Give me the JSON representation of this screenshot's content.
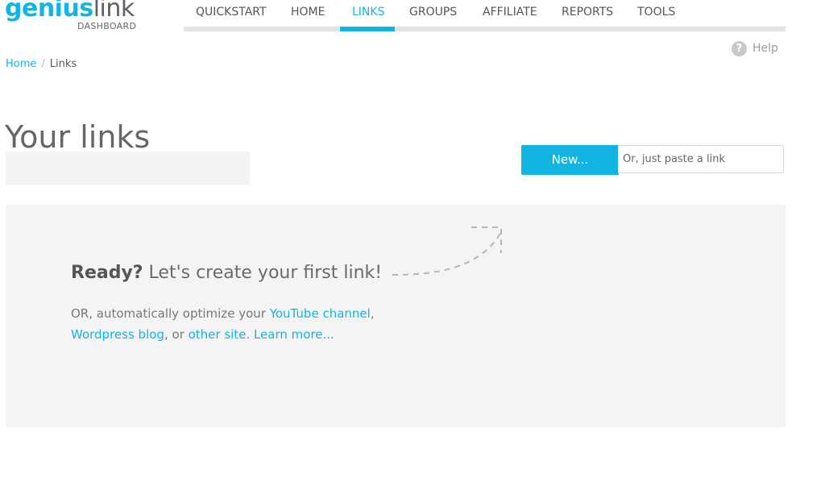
{
  "logo": {
    "genius": "genius",
    "link": "link",
    "subtitle": "DASHBOARD"
  },
  "nav": {
    "items": [
      "QUICKSTART",
      "HOME",
      "LINKS",
      "GROUPS",
      "AFFILIATE",
      "REPORTS",
      "TOOLS"
    ],
    "active": "LINKS"
  },
  "help": {
    "label": "Help",
    "icon": "question-circle-icon"
  },
  "breadcrumb": {
    "home": "Home",
    "separator": "/",
    "current": "Links"
  },
  "page_title": "Your links",
  "actions": {
    "new_label": "New...",
    "paste_placeholder": "Or, just paste a link"
  },
  "empty_state": {
    "ready_bold": "Ready?",
    "ready_rest": " Let's create your first link!",
    "or_prefix": "OR, automatically optimize your ",
    "youtube": "YouTube channel",
    "comma": ",",
    "wordpress": "Wordpress blog",
    "or_mid": ", or ",
    "other_site": "other site.",
    "learn_more": "Learn more..."
  },
  "colors": {
    "accent": "#12b4e2",
    "panel": "#f4f4f4",
    "nav_bar": "#e3e3e3"
  }
}
